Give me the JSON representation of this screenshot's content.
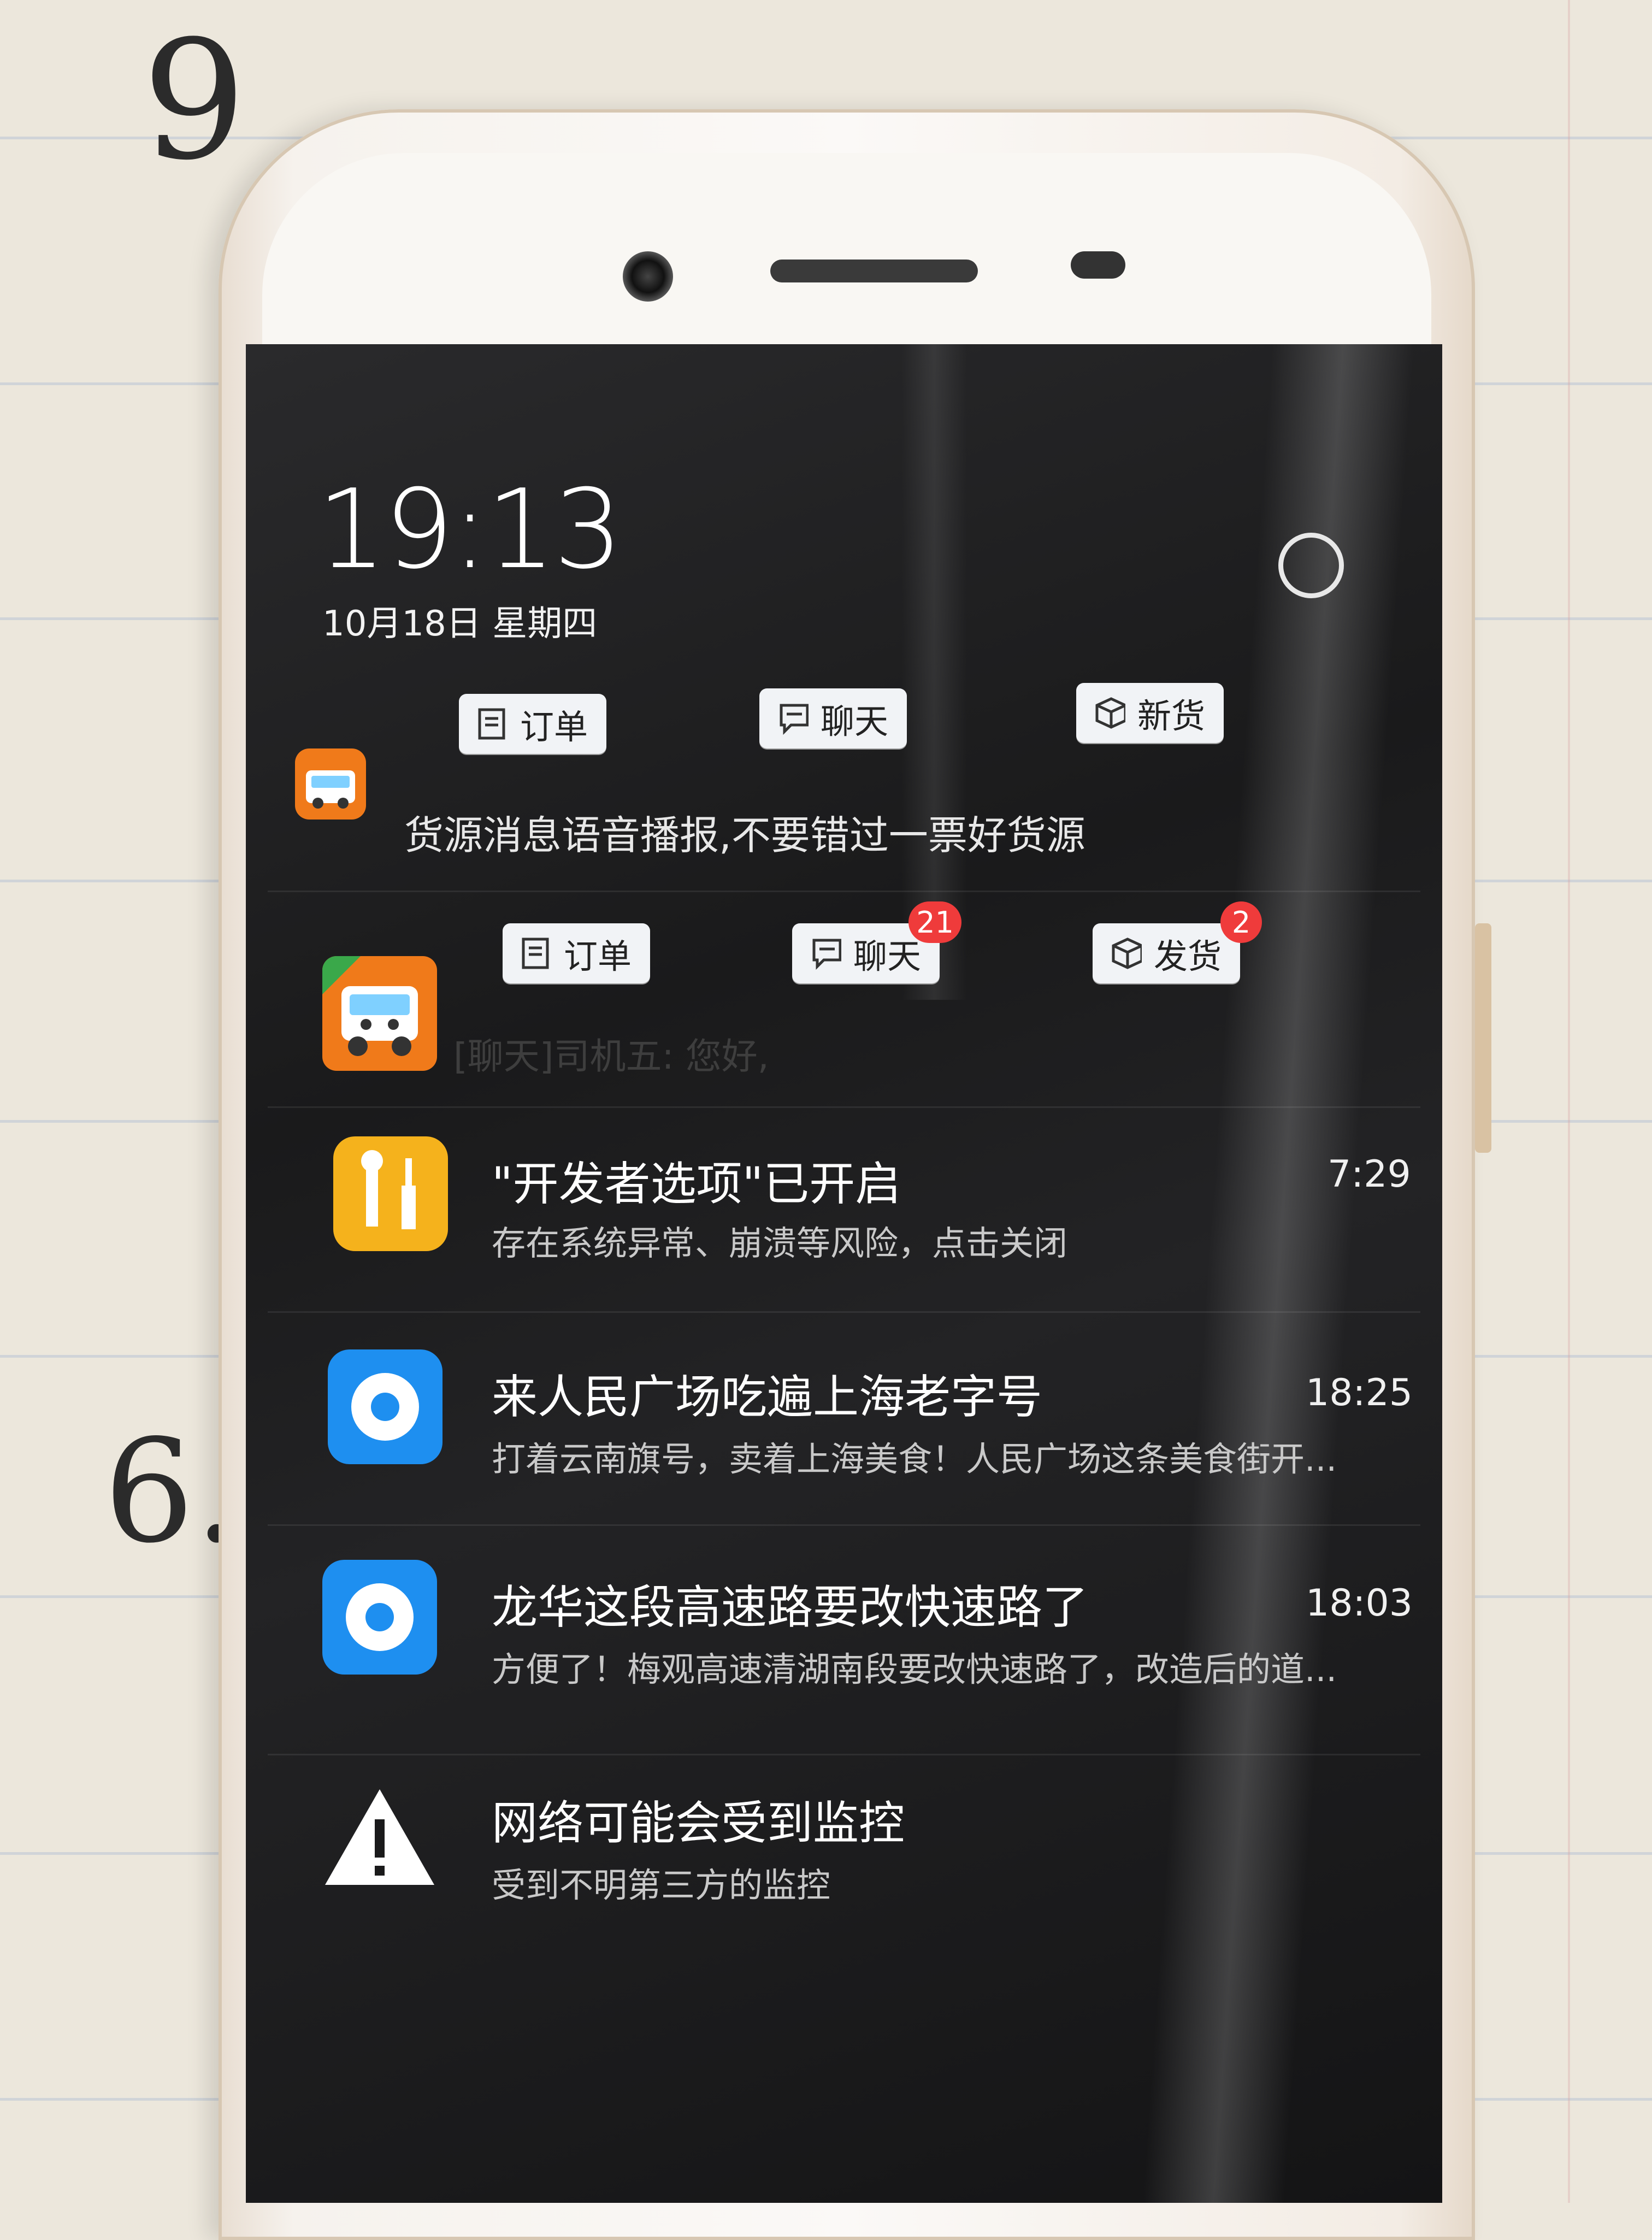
{
  "lockscreen": {
    "time": "19:13",
    "date": "10月18日 星期四"
  },
  "notifications": [
    {
      "app": "truck-app-driver",
      "actions": [
        {
          "label": "订单",
          "icon": "order-icon"
        },
        {
          "label": "聊天",
          "icon": "chat-icon"
        },
        {
          "label": "新货",
          "icon": "box-icon"
        }
      ],
      "text": "货源消息语音播报,不要错过一票好货源"
    },
    {
      "app": "truck-app-shipper",
      "actions": [
        {
          "label": "订单",
          "icon": "order-icon",
          "badge": ""
        },
        {
          "label": "聊天",
          "icon": "chat-icon",
          "badge": "21"
        },
        {
          "label": "发货",
          "icon": "box-icon",
          "badge": "2"
        }
      ],
      "text": "[聊天]司机五: 您好,"
    },
    {
      "app": "developer-settings",
      "title": "\"开发者选项\"已开启",
      "time": "7:29",
      "text": "存在系统异常、崩溃等风险，点击关闭"
    },
    {
      "app": "news-app",
      "title": "来人民广场吃遍上海老字号",
      "time": "18:25",
      "text": "打着云南旗号，卖着上海美食！人民广场这条美食街开..."
    },
    {
      "app": "news-app",
      "title": "龙华这段高速路要改快速路了",
      "time": "18:03",
      "text": "方便了！梅观高速清湖南段要改快速路了，改造后的道..."
    },
    {
      "app": "system-warning",
      "title": "网络可能会受到监控",
      "text": "受到不明第三方的监控"
    }
  ],
  "colors": {
    "badge": "#ef3b3b",
    "truck_orange": "#f07a1a",
    "dev_yellow": "#f5b21c",
    "news_blue": "#1e8ff0"
  }
}
